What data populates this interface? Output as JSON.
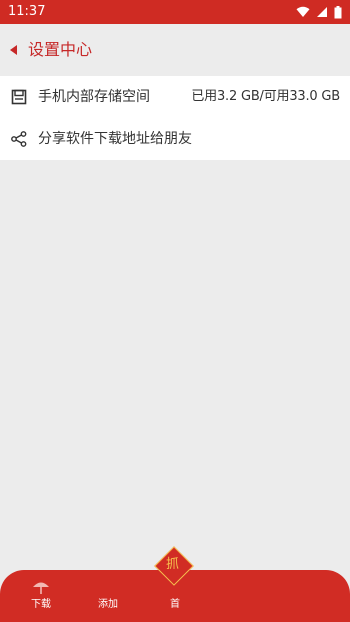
{
  "status_bar": {
    "time": "11:37"
  },
  "header": {
    "title": "设置中心"
  },
  "settings": {
    "items": [
      {
        "icon": "storage-icon",
        "label": "手机内部存储空间",
        "value": "已用3.2 GB/可用33.0 GB"
      },
      {
        "icon": "share-icon",
        "label": "分享软件下载地址给朋友"
      }
    ]
  },
  "bottom_nav": {
    "items": [
      {
        "label": "下载",
        "icon": "umbrella-icon"
      },
      {
        "label": "添加"
      },
      {
        "label": "首"
      }
    ],
    "center_badge": "抓"
  },
  "colors": {
    "primary": "#d12c24",
    "background": "#ececec",
    "title_text": "#c62828",
    "badge": "#f6c14e"
  }
}
